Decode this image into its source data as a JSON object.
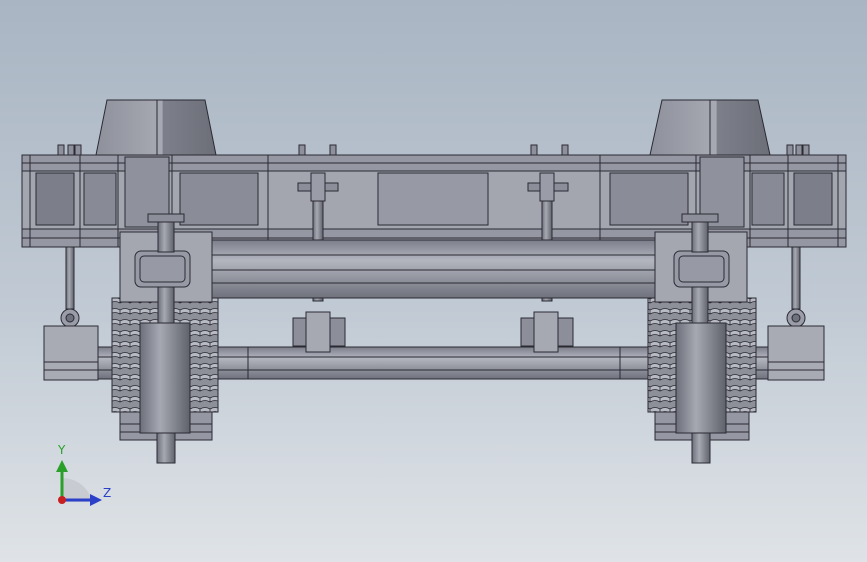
{
  "viewport": {
    "background_top": "#a9b5c3",
    "background_bottom": "#dfe3e7"
  },
  "model": {
    "part_color": "#9a9ca8",
    "edge_color": "#2a2a33"
  },
  "triad": {
    "y_label": "Y",
    "z_label": "Z",
    "y_color": "#2aa02a",
    "z_color": "#2b3fc8",
    "x_color": "#c82020"
  }
}
